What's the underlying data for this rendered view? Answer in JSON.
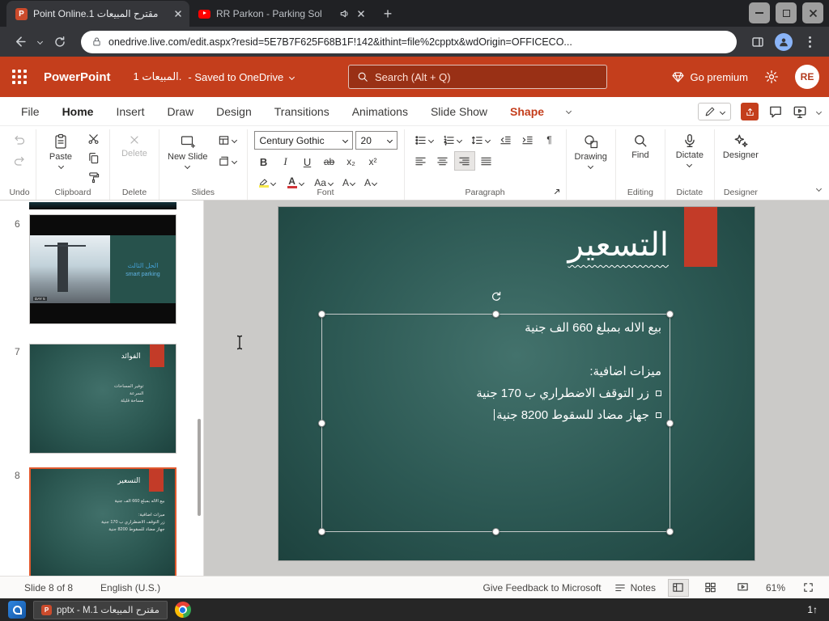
{
  "browser": {
    "tab1": "Point Online.1 مقترح المبيعات",
    "tab2": "RR Parkon - Parking Sol",
    "new_tab": "+",
    "url": "onedrive.live.com/edit.aspx?resid=5E7B7F625F68B1F!142&ithint=file%2cpptx&wdOrigin=OFFICECO..."
  },
  "header": {
    "app_name": "PowerPoint",
    "doc_name": "المبيعات 1.",
    "saved_status": "- Saved to OneDrive",
    "search_placeholder": "Search (Alt + Q)",
    "premium_label": "Go premium",
    "avatar": "RE"
  },
  "menu": {
    "items": [
      "File",
      "Home",
      "Insert",
      "Draw",
      "Design",
      "Transitions",
      "Animations",
      "Slide Show"
    ],
    "shape_tab": "Shape"
  },
  "ribbon": {
    "paste": "Paste",
    "delete": "Delete",
    "new_slide": "New Slide",
    "font_name": "Century Gothic",
    "font_size": "20",
    "bold": "B",
    "italic": "I",
    "underline": "U",
    "strike": "ab",
    "subscript": "x₂",
    "superscript": "x²",
    "font_color": "A",
    "change_case": "Aa",
    "grow_font": "A",
    "shrink_font": "A",
    "drawing": "Drawing",
    "find": "Find",
    "dictate": "Dictate",
    "designer": "Designer",
    "groups": {
      "undo": "Undo",
      "clipboard": "Clipboard",
      "delete": "Delete",
      "slides": "Slides",
      "font": "Font",
      "paragraph": "Paragraph",
      "editing": "Editing",
      "dictate": "Dictate",
      "designer": "Designer"
    }
  },
  "panel": {
    "slides": [
      {
        "number": "6",
        "line1": "الحل الثالث",
        "line2": "smart parking",
        "day_label": "DAY 5"
      },
      {
        "number": "7",
        "title": "الفوائد",
        "bullets": [
          "توفير المساحات",
          "السرعة",
          "مساحة قليلة"
        ]
      },
      {
        "number": "8",
        "title": "التسعير"
      }
    ]
  },
  "slide": {
    "title": "التسعير",
    "lines": [
      {
        "text": "بيع الاله بمبلغ 660 الف جنية"
      },
      {
        "text": ""
      },
      {
        "text": "ميزات اضافية:"
      },
      {
        "text": "زر التوقف الاضطراري ب 170 جنية"
      },
      {
        "text": "جهاز مضاد للسقوط 8200 جنية"
      }
    ]
  },
  "statusbar": {
    "slide_info": "Slide 8 of 8",
    "language": "English (U.S.)",
    "feedback": "Give Feedback to Microsoft",
    "notes": "Notes",
    "zoom": "61%"
  },
  "taskbar": {
    "window_title": "pptx - M.1 مقترح المبيعات",
    "indicator": "1↑"
  }
}
